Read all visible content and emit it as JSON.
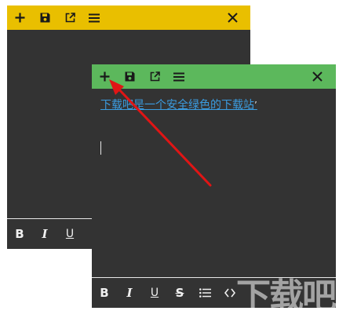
{
  "back_note": {
    "title_color": "#e9bf00",
    "icons": [
      "plus-icon",
      "save-icon",
      "external-link-icon",
      "menu-icon",
      "close-icon"
    ],
    "format_labels": {
      "bold": "B",
      "italic": "I",
      "underline": "U"
    }
  },
  "front_note": {
    "title_color": "#5cb85c",
    "icons": [
      "plus-icon",
      "save-icon",
      "external-link-icon",
      "menu-icon",
      "close-icon"
    ],
    "content_link": "下载吧是一个安全绿色的下载站",
    "content_suffix": "’",
    "format_labels": {
      "bold": "B",
      "italic": "I",
      "underline": "U",
      "strike": "S"
    }
  },
  "annotation": {
    "arrow_color": "#e01515",
    "target": "plus-button"
  },
  "watermark": {
    "text": "下载吧"
  }
}
